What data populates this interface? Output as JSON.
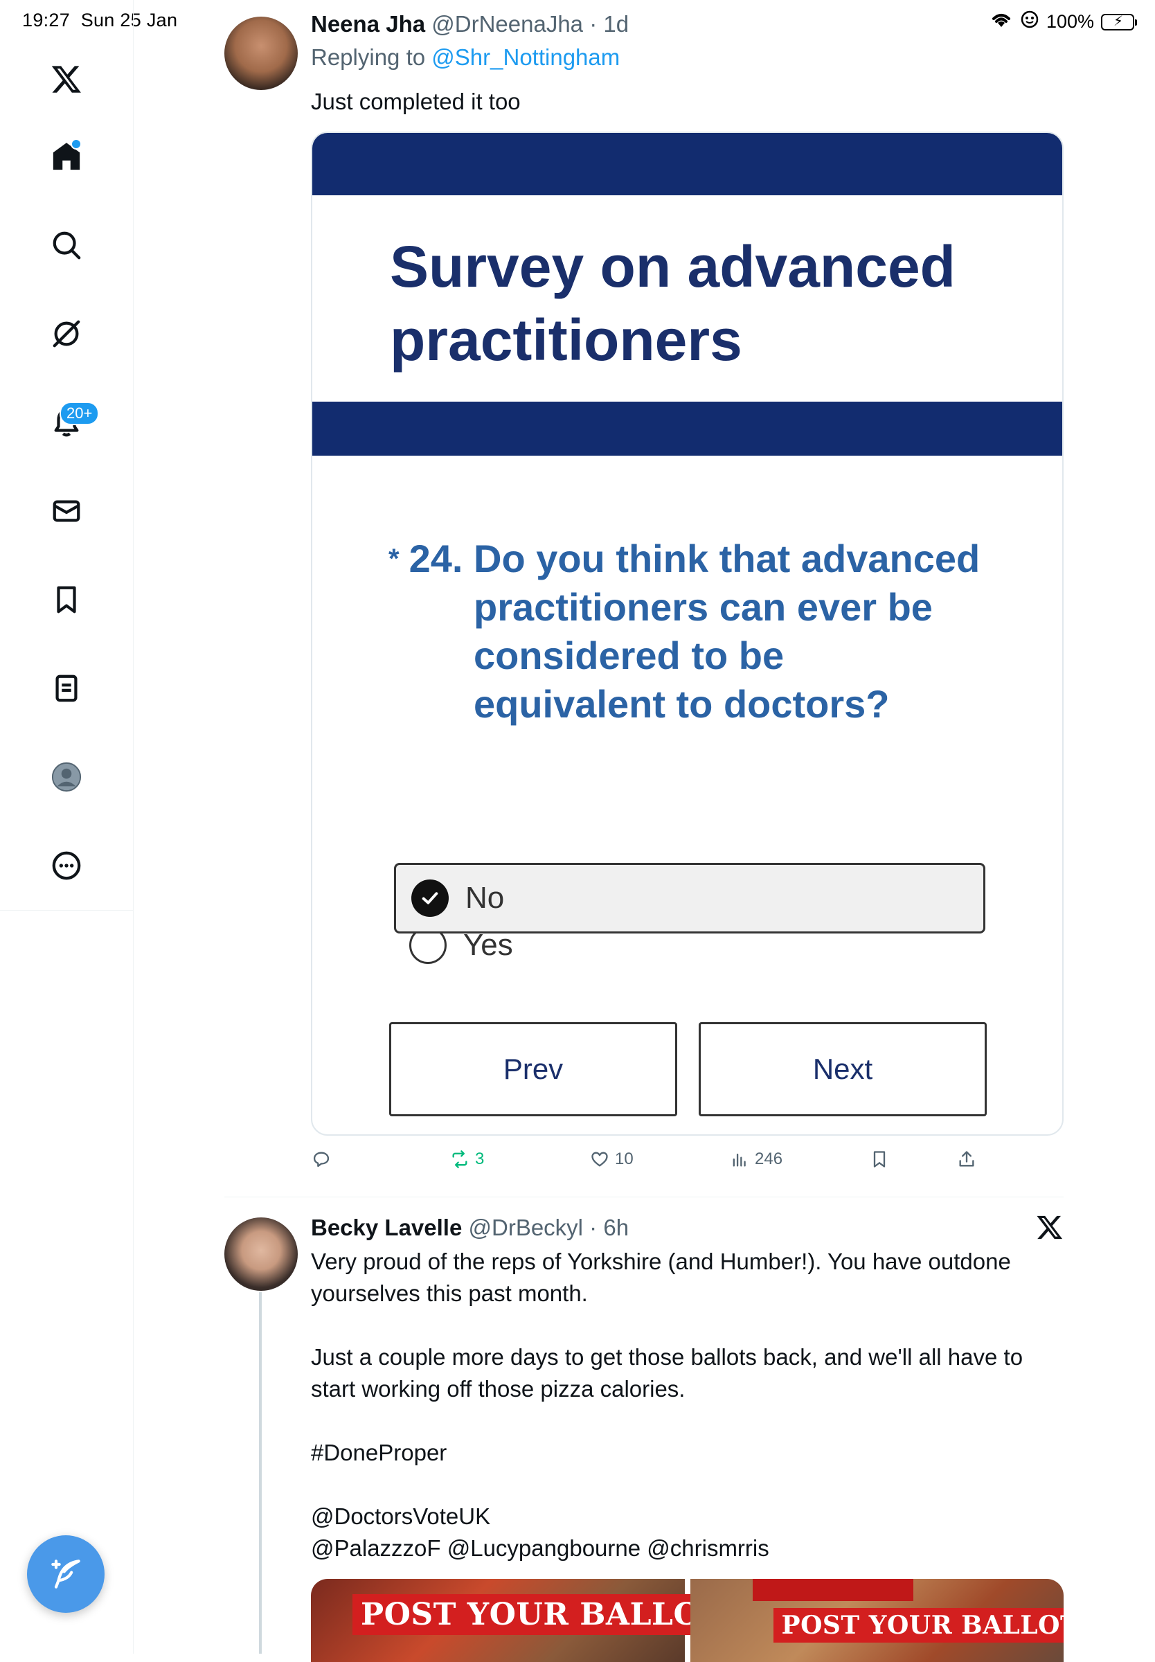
{
  "status_bar": {
    "time": "19:27",
    "date": "Sun 25 Jan",
    "battery": "100%"
  },
  "sidebar": {
    "notifications_badge": "20+",
    "items": [
      {
        "name": "x-logo-icon"
      },
      {
        "name": "home-icon"
      },
      {
        "name": "search-icon"
      },
      {
        "name": "grok-icon"
      },
      {
        "name": "bell-icon"
      },
      {
        "name": "mail-icon"
      },
      {
        "name": "bookmark-icon"
      },
      {
        "name": "lists-icon"
      },
      {
        "name": "profile-icon"
      },
      {
        "name": "more-icon"
      }
    ],
    "accent_color": "#1d9bf0"
  },
  "tweet1": {
    "name": "Neena Jha",
    "handle": "@DrNeenaJha",
    "time": "1d",
    "replying_prefix": "Replying to",
    "replying_handle": "@Shr_Nottingham",
    "text": "Just completed it too",
    "survey": {
      "title": "Survey on advanced practitioners",
      "question_star": "*",
      "question_number": "24.",
      "question": "Do you think that advanced practitioners can ever be considered to be equivalent to doctors?",
      "option_yes": "Yes",
      "option_no": "No",
      "selected": "No",
      "prev_label": "Prev",
      "next_label": "Next"
    },
    "actions": {
      "retweets": "3",
      "likes": "10",
      "views": "246"
    }
  },
  "tweet2": {
    "name": "Becky Lavelle",
    "handle": "@DrBeckyl",
    "time": "6h",
    "text": "Very proud of the reps of Yorkshire (and Humber!). You have outdone yourselves this past month.\n\nJust a couple more days to get those ballots back, and we'll all have to start working off those pizza calories.\n\n#DoneProper\n\n@DoctorsVoteUK\n@PalazzzoF @Lucypangbourne @chrismrris",
    "image_banner_left": "POST YOUR BALLOT",
    "image_banner_right": "POST YOUR BALLOT"
  }
}
